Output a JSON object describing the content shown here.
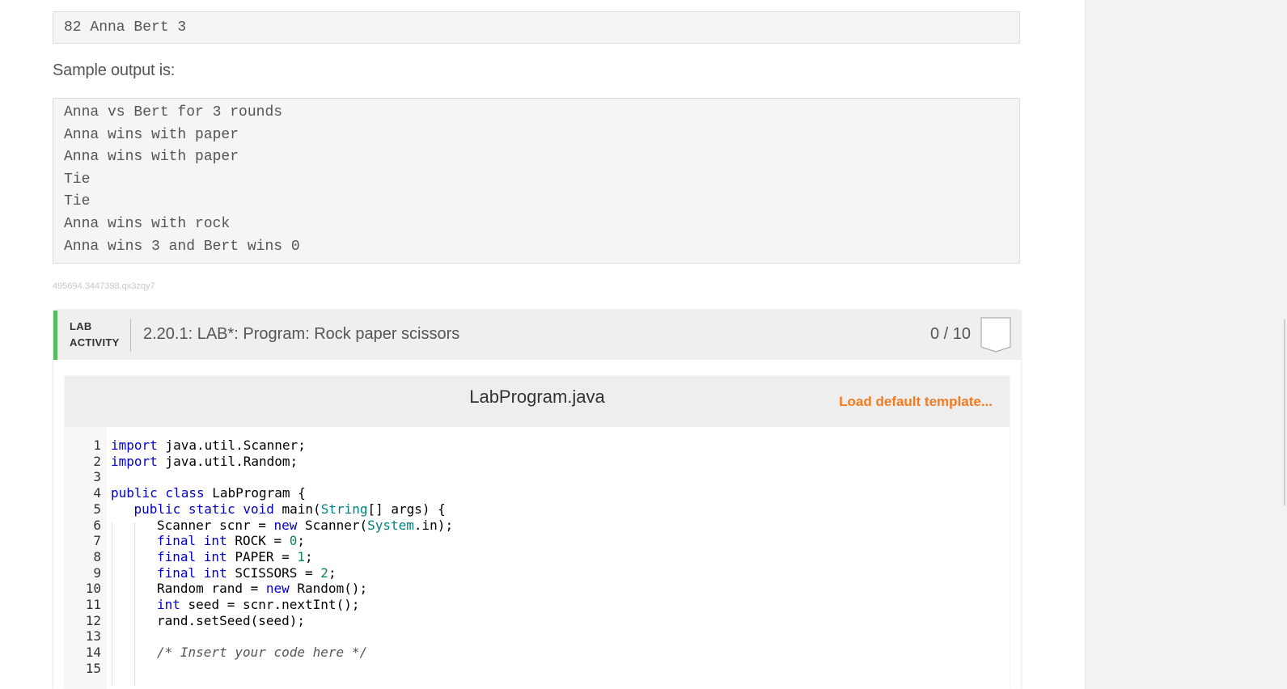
{
  "sample_input": {
    "lines": [
      "82 Anna Bert 3"
    ]
  },
  "sample_output_label": "Sample output is:",
  "sample_output": {
    "lines": [
      "Anna vs Bert for 3 rounds",
      "Anna wins with paper",
      "Anna wins with paper",
      "Tie",
      "Tie",
      "Anna wins with rock",
      "Anna wins 3 and Bert wins 0"
    ]
  },
  "content_id": "495694.3447398.qx3zqy7",
  "lab": {
    "type_line1": "LAB",
    "type_line2": "ACTIVITY",
    "title": "2.20.1: LAB*: Program: Rock paper scissors",
    "score": "0 / 10",
    "accent_color": "#5cb85c"
  },
  "editor": {
    "file_name": "LabProgram.java",
    "load_template_label": "Load default template...",
    "load_template_color": "#f47a20",
    "lines": [
      {
        "n": "1",
        "indent": 0,
        "tokens": [
          {
            "t": "import",
            "c": "kw"
          },
          {
            "t": " java.util.Scanner;",
            "c": ""
          }
        ]
      },
      {
        "n": "2",
        "indent": 0,
        "tokens": [
          {
            "t": "import",
            "c": "kw"
          },
          {
            "t": " java.util.Random;",
            "c": ""
          }
        ]
      },
      {
        "n": "3",
        "indent": 0,
        "tokens": []
      },
      {
        "n": "4",
        "indent": 0,
        "tokens": [
          {
            "t": "public class",
            "c": "kw"
          },
          {
            "t": " LabProgram {",
            "c": ""
          }
        ]
      },
      {
        "n": "5",
        "indent": 1,
        "tokens": [
          {
            "t": "public static void",
            "c": "kw"
          },
          {
            "t": " main(",
            "c": ""
          },
          {
            "t": "String",
            "c": "ty"
          },
          {
            "t": "[] args) {",
            "c": ""
          }
        ]
      },
      {
        "n": "6",
        "indent": 2,
        "tokens": [
          {
            "t": "Scanner scnr = ",
            "c": ""
          },
          {
            "t": "new",
            "c": "kw"
          },
          {
            "t": " Scanner(",
            "c": ""
          },
          {
            "t": "System",
            "c": "ty"
          },
          {
            "t": ".in);",
            "c": ""
          }
        ]
      },
      {
        "n": "7",
        "indent": 2,
        "tokens": [
          {
            "t": "final int",
            "c": "kw"
          },
          {
            "t": " ROCK = ",
            "c": ""
          },
          {
            "t": "0",
            "c": "num"
          },
          {
            "t": ";",
            "c": ""
          }
        ]
      },
      {
        "n": "8",
        "indent": 2,
        "tokens": [
          {
            "t": "final int",
            "c": "kw"
          },
          {
            "t": " PAPER = ",
            "c": ""
          },
          {
            "t": "1",
            "c": "num"
          },
          {
            "t": ";",
            "c": ""
          }
        ]
      },
      {
        "n": "9",
        "indent": 2,
        "tokens": [
          {
            "t": "final int",
            "c": "kw"
          },
          {
            "t": " SCISSORS = ",
            "c": ""
          },
          {
            "t": "2",
            "c": "num"
          },
          {
            "t": ";",
            "c": ""
          }
        ]
      },
      {
        "n": "10",
        "indent": 2,
        "tokens": [
          {
            "t": "Random rand = ",
            "c": ""
          },
          {
            "t": "new",
            "c": "kw"
          },
          {
            "t": " Random();",
            "c": ""
          }
        ]
      },
      {
        "n": "11",
        "indent": 2,
        "tokens": [
          {
            "t": "int",
            "c": "kw"
          },
          {
            "t": " seed = scnr.nextInt();",
            "c": ""
          }
        ]
      },
      {
        "n": "12",
        "indent": 2,
        "tokens": [
          {
            "t": "rand.setSeed(seed);",
            "c": ""
          }
        ]
      },
      {
        "n": "13",
        "indent": 0,
        "tokens": []
      },
      {
        "n": "14",
        "indent": 2,
        "tokens": [
          {
            "t": "/* Insert your code here */",
            "c": "cm"
          }
        ]
      },
      {
        "n": "15",
        "indent": 0,
        "tokens": []
      }
    ]
  }
}
